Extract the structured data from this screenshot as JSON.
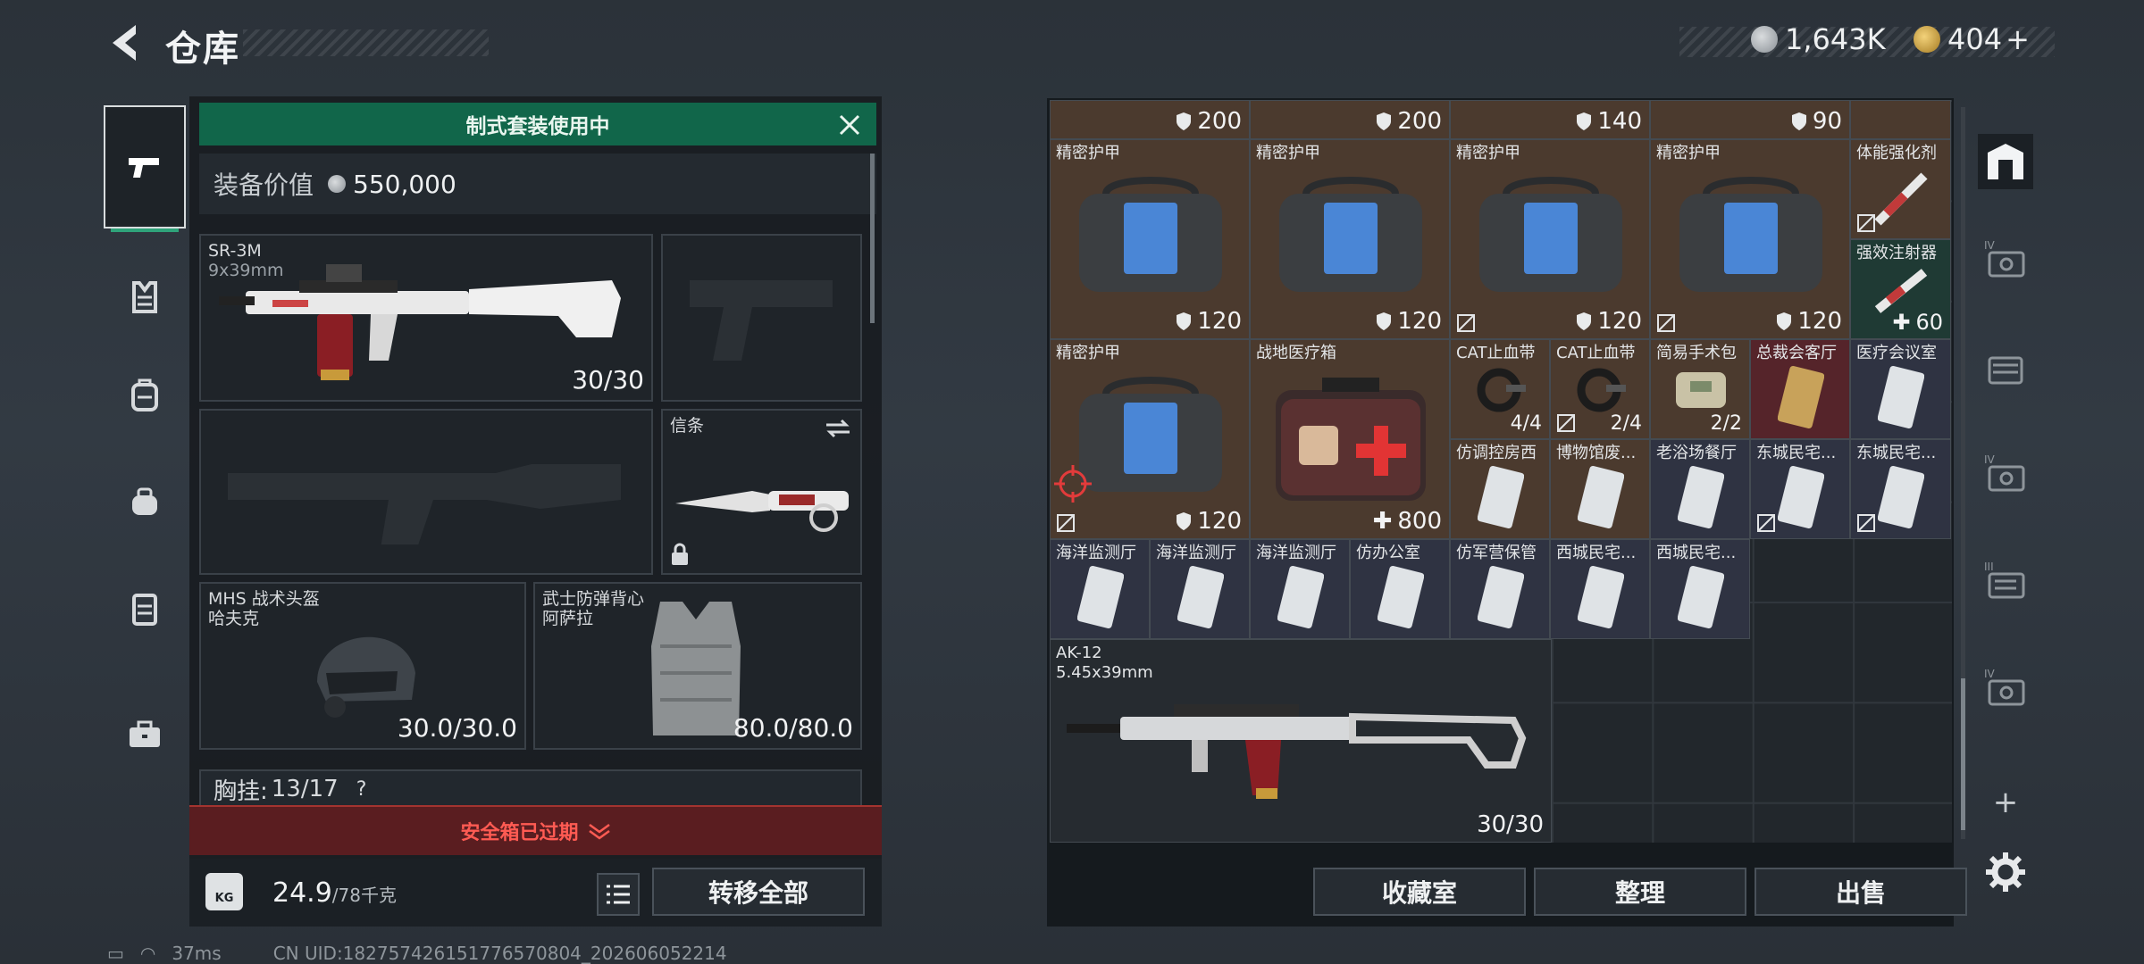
{
  "header": {
    "title": "仓库",
    "currency1": "1,643K",
    "currency2": "404",
    "currency2_plus": "+"
  },
  "loadout": {
    "banner": "制式套装使用中",
    "value_label": "装备价值",
    "value": "550,000",
    "primary": {
      "name": "SR-3M",
      "caliber": "9x39mm",
      "ammo": "30/30"
    },
    "melee": {
      "name": "信条"
    },
    "helmet": {
      "name": "MHS 战术头盔",
      "brand": "哈夫克",
      "durability": "30.0/30.0"
    },
    "armor": {
      "name": "武士防弹背心",
      "brand": "阿萨拉",
      "durability": "80.0/80.0"
    },
    "chest_label": "胸挂:",
    "chest_value": "13/17",
    "chest_help": "?",
    "expired": "安全箱已过期",
    "weight": "24.9",
    "weight_max": "/78千克",
    "kg_label": "KG",
    "transfer_all": "转移全部"
  },
  "status": {
    "ping": "37ms",
    "uid": "CN UID:182757426151776570804_202606052214"
  },
  "storage": {
    "top_values": [
      "200",
      "200",
      "140",
      "90"
    ],
    "row1": [
      {
        "name": "精密护甲",
        "value": "120"
      },
      {
        "name": "精密护甲",
        "value": "120"
      },
      {
        "name": "精密护甲",
        "value": "120"
      },
      {
        "name": "精密护甲",
        "value": "120"
      }
    ],
    "stim1": "体能强化剂",
    "stim2": "强效注射器",
    "stim2_value": "60",
    "armor5": {
      "name": "精密护甲",
      "value": "120"
    },
    "medkit": {
      "name": "战地医疗箱",
      "value": "800"
    },
    "small1": [
      {
        "name": "CAT止血带",
        "value": "4/4"
      },
      {
        "name": "CAT止血带",
        "value": "2/4"
      },
      {
        "name": "简易手术包",
        "value": "2/2"
      },
      {
        "name": "总裁会客厅"
      },
      {
        "name": "医疗会议室"
      }
    ],
    "small2": [
      {
        "name": "仿调控房西"
      },
      {
        "name": "博物馆废..."
      },
      {
        "name": "老浴场餐厅"
      },
      {
        "name": "东城民宅..."
      },
      {
        "name": "东城民宅..."
      }
    ],
    "small3": [
      {
        "name": "海洋监测厅"
      },
      {
        "name": "海洋监测厅"
      },
      {
        "name": "海洋监测厅"
      },
      {
        "name": "仿办公室"
      },
      {
        "name": "仿军营保管"
      },
      {
        "name": "西城民宅..."
      },
      {
        "name": "西城民宅..."
      }
    ],
    "ak": {
      "name": "AK-12",
      "caliber": "5.45x39mm",
      "ammo": "30/30"
    },
    "buttons": {
      "collection": "收藏室",
      "sort": "整理",
      "sell": "出售"
    },
    "add": "+"
  },
  "colors": {
    "accent_green": "#11664a",
    "alert_red": "#ff5b53"
  }
}
